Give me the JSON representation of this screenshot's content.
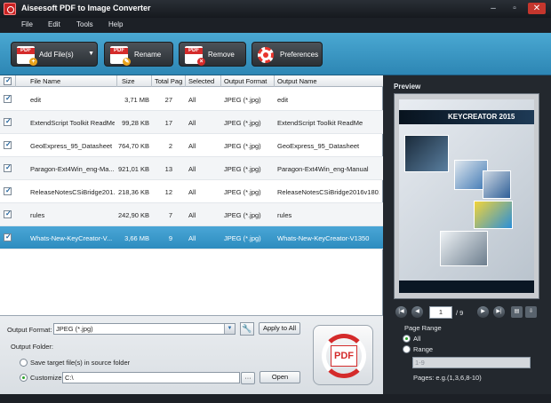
{
  "window": {
    "title": "Aiseesoft PDF to Image Converter"
  },
  "menu": [
    "File",
    "Edit",
    "Tools",
    "Help"
  ],
  "toolbar": {
    "add_files": "Add File(s)",
    "rename": "Rename",
    "remove": "Remove",
    "preferences": "Preferences"
  },
  "table": {
    "headers": {
      "file_name": "File Name",
      "size": "Size",
      "total_pages": "Total Pag",
      "selected": "Selected",
      "output_format": "Output Format",
      "output_name": "Output Name"
    },
    "rows": [
      {
        "name": "edit",
        "size": "3,71 MB",
        "pages": "27",
        "selected": "All",
        "format": "JPEG (*.jpg)",
        "output": "edit"
      },
      {
        "name": "ExtendScript Toolkit ReadMe",
        "size": "99,28 KB",
        "pages": "17",
        "selected": "All",
        "format": "JPEG (*.jpg)",
        "output": "ExtendScript Toolkit ReadMe"
      },
      {
        "name": "GeoExpress_95_Datasheet",
        "size": "764,70 KB",
        "pages": "2",
        "selected": "All",
        "format": "JPEG (*.jpg)",
        "output": "GeoExpress_95_Datasheet"
      },
      {
        "name": "Paragon-Ext4Win_eng-Ma...",
        "size": "921,01 KB",
        "pages": "13",
        "selected": "All",
        "format": "JPEG (*.jpg)",
        "output": "Paragon-Ext4Win_eng-Manual"
      },
      {
        "name": "ReleaseNotesCSiBridge201...",
        "size": "218,36 KB",
        "pages": "12",
        "selected": "All",
        "format": "JPEG (*.jpg)",
        "output": "ReleaseNotesCSiBridge2016v1801"
      },
      {
        "name": "rules",
        "size": "242,90 KB",
        "pages": "7",
        "selected": "All",
        "format": "JPEG (*.jpg)",
        "output": "rules"
      },
      {
        "name": "Whats-New-KeyCreator-V...",
        "size": "3,66 MB",
        "pages": "9",
        "selected": "All",
        "format": "JPEG (*.jpg)",
        "output": "Whats-New-KeyCreator-V1350"
      }
    ]
  },
  "output": {
    "format_label": "Output Format:",
    "format_value": "JPEG (*.jpg)",
    "apply_all": "Apply to All",
    "folder_label": "Output Folder:",
    "save_source": "Save target file(s) in source folder",
    "customize": "Customize:",
    "path": "C:\\",
    "browse": "···",
    "open": "Open",
    "convert_label": "PDF"
  },
  "preview": {
    "title": "Preview",
    "doc_banner": "KEYCREATOR 2015",
    "current_page": "1",
    "total_pages": "/ 9",
    "page_range_label": "Page Range",
    "all": "All",
    "range": "Range",
    "range_value": "1-9",
    "hint": "Pages: e.g.(1,3,6,8-10)"
  },
  "colors": {
    "accent": "#2d8cbf",
    "toolbar": "#3e9ccb",
    "convert": "#d42b2b"
  }
}
